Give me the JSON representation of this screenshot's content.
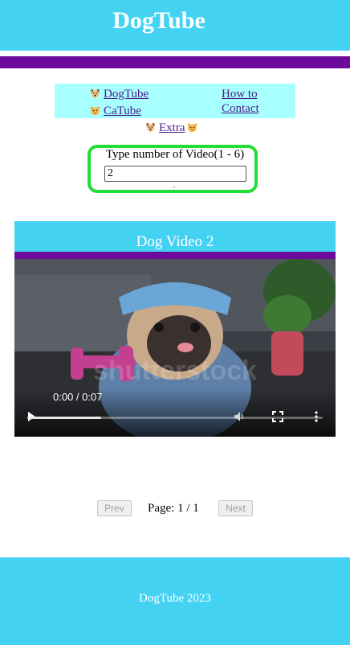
{
  "header": {
    "title": "DogTube"
  },
  "nav": {
    "dogtube": "DogTube",
    "catube": "CaTube",
    "howto_line1": "How to",
    "howto_line2": "Contact",
    "extra": "Extra"
  },
  "video_input": {
    "label": "Type number of Video(1 - 6)",
    "value": "2"
  },
  "video": {
    "title": "Dog Video 2",
    "time": "0:00 / 0:07",
    "progress_fraction": 0.25
  },
  "pagination": {
    "prev": "Prev",
    "page_label": "Page:",
    "current": "1",
    "separator": "/",
    "total": "1",
    "next": "Next"
  },
  "footer": {
    "text": "DogTube 2023"
  },
  "colors": {
    "accent": "#44d2f3",
    "purple": "#6c0a9c",
    "nav_bg": "#a8ffff",
    "input_border": "#22dd33"
  }
}
